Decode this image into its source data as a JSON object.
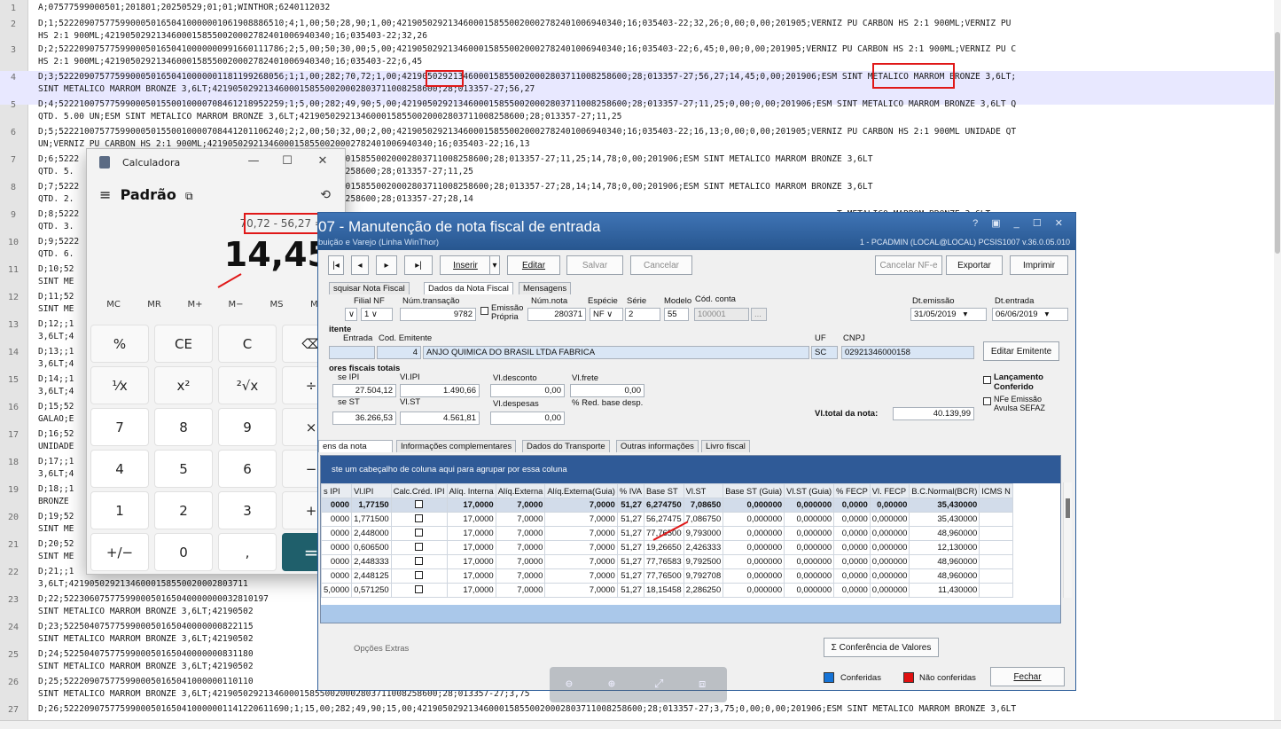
{
  "editor": {
    "lines": [
      {
        "n": "1",
        "text": [
          "A;07577599000501;201801;20250529;01;01;WINTHOR;6240112032"
        ]
      },
      {
        "n": "2",
        "text": [
          "D;1;52220907577599000501650410000001061908886510;4;1,00;50;28,90;1,00;42190502921346000158550020002782401006940340;16;035403-22;32,26;0,00;0,00;201905;VERNIZ PU CARBON HS 2:1 900ML;VERNIZ PU",
          "HS 2:1 900ML;42190502921346000158550020002782401006940340;16;035403-22;32,26"
        ]
      },
      {
        "n": "3",
        "text": [
          "D;2;52220907577599000501650410000000991660111786;2;5,00;50;30,00;5,00;42190502921346000158550020002782401006940340;16;035403-22;6,45;0,00;0,00;201905;VERNIZ PU CARBON HS 2:1 900ML;VERNIZ PU C",
          "HS 2:1 900ML;42190502921346000158550020002782401006940340;16;035403-22;6,45"
        ]
      },
      {
        "n": "4",
        "text": [
          "D;3;52220907577599000501650410000001181199268056;1;1,00;282;70,72;1,00;42190502921346000158550020002803711008258600;28;013357-27;56,27;14,45;0,00;201906;ESM SINT METALICO MARROM BRONZE 3,6LT;",
          "SINT METALICO MARROM BRONZE 3,6LT;42190502921346000158550020002803711008258600;28;013357-27;56,27"
        ]
      },
      {
        "n": "5",
        "text": [
          "D;4;52221007577599000501550010000708461218952259;1;5,00;282;49,90;5,00;42190502921346000158550020002803711008258600;28;013357-27;11,25;0,00;0,00;201906;ESM SINT METALICO MARROM BRONZE 3,6LT Q",
          "QTD. 5.00 UN;ESM SINT METALICO MARROM BRONZE 3,6LT;42190502921346000158550020002803711008258600;28;013357-27;11,25"
        ]
      },
      {
        "n": "6",
        "text": [
          "D;5;52221007577599000501550010000708441201106240;2;2,00;50;32,00;2,00;42190502921346000158550020002782401006940340;16;035403-22;16,13;0,00;0,00;201905;VERNIZ PU CARBON HS 2:1 900ML UNIDADE QT",
          "UN;VERNIZ PU CARBON HS 2:1 900ML;42190502921346000158550020002782401006940340;16;035403-22;16,13"
        ]
      },
      {
        "n": "7",
        "text": [
          "D;6;5222            4;2;5,00;282;71,06;5,00;42190502921346000158550020002803711008258600;28;013357-27;11,25;14,78;0,00;201906;ESM SINT METALICO MARROM BRONZE 3,6LT",
          "QTD. 5.            LT;42190502921346000158550020002803711008258600;28;013357-27;11,25"
        ]
      },
      {
        "n": "8",
        "text": [
          "D;7;5222            0;2;2,00;282;71,06;2,00;42190502921346000158550020002803711008258600;28;013357-27;28,14;14,78;0,00;201906;ESM SINT METALICO MARROM BRONZE 3,6LT",
          "QTD. 2.            LT;42190502921346000158550020002803711008258600;28;013357-27;28,14"
        ]
      },
      {
        "n": "9",
        "text": [
          "D;8;5222                                                                                                                                                    T METALICO MARROM BRONZE 3,6LT",
          "QTD. 3."
        ]
      },
      {
        "n": "10",
        "text": [
          "D;9;5222                                                                                                                                                    METALICO MARROM BRONZE 3,6LT Q",
          "QTD. 6."
        ]
      },
      {
        "n": "11",
        "text": [
          "D;10;52                                                                                                                                                    INT METALICO MARROM BRONZE 3,6L",
          "SINT ME"
        ]
      },
      {
        "n": "12",
        "text": [
          "D;11;52                                                                                                                                                    T METALICO MARROM BRONZE 3,6LT;",
          "SINT ME"
        ]
      },
      {
        "n": "13",
        "text": [
          "D;12;;1                                                                                                                                                    M AVELA",
          "3,6LT;4"
        ]
      },
      {
        "n": "14",
        "text": [
          "D;13;;1                                                                                                                                                    AVELA",
          "3,6LT;4"
        ]
      },
      {
        "n": "15",
        "text": [
          "D;14;;1                                                                                                                                                    ALICO MARROM BRONZE",
          "3,6LT;4"
        ]
      },
      {
        "n": "16",
        "text": [
          "D;15;52                                                                                                                                                    NT METALICO MARROM BRONZE 3,6LT",
          "GALAO;E"
        ]
      },
      {
        "n": "17",
        "text": [
          "D;16;52                                                                                                                                                    SINT METALICO MARROM BRONZE 3,6L",
          "UNIDADE"
        ]
      },
      {
        "n": "18",
        "text": [
          "D;17;;1                                                                                                                                                    SAVOIA",
          "3,6LT;4"
        ]
      },
      {
        "n": "19",
        "text": [
          "D;18;;1                                                                                                                                                    D. 1.00 UN;ESM SINT METALICO MA",
          "BRONZE"
        ]
      },
      {
        "n": "20",
        "text": [
          "D;19;52                                                                                                                                                    SINT METALICO MARROM BRONZE 3,6",
          "SINT ME"
        ]
      },
      {
        "n": "21",
        "text": [
          "D;20;52                                                                                                                                                    SINT METALICO MARROM BRONZE 3,6",
          "SINT ME"
        ]
      },
      {
        "n": "22",
        "text": [
          "D;21;;1                                                                                                                                                    ALICO MARROM BRONZE",
          "3,6LT;42190502921346000158550020002803711"
        ]
      },
      {
        "n": "23",
        "text": [
          "D;22;5223060757759900050165040000000032810197                                                                                                              NT METALICO MARROM BRONZE 3,6LT",
          "SINT METALICO MARROM BRONZE 3,6LT;42190502"
        ]
      },
      {
        "n": "24",
        "text": [
          "D;23;5225040757759900050165040000000822115                                                                                                                NT METALICO MARROM BRONZE 3,6LT",
          "SINT METALICO MARROM BRONZE 3,6LT;42190502"
        ]
      },
      {
        "n": "25",
        "text": [
          "D;24;5225040757759900050165040000000831180                                                                                                                NT METALICO MARROM BRONZE 3,6LT",
          "SINT METALICO MARROM BRONZE 3,6LT;42190502"
        ]
      },
      {
        "n": "26",
        "text": [
          "D;25;5222090757759900050165041000000110110                                                                                                                NT METALICO MARROM BRONZE 3,6LT",
          "SINT METALICO MARROM BRONZE 3,6LT;42190502921346000158550020002803711008258600;28;013357-27;3,75"
        ]
      },
      {
        "n": "27",
        "text": [
          "D;26;52220907577599000501650410000001141220611690;1;15,00;282;49,90;15,00;42190502921346000158550020002803711008258600;28;013357-27;3,75;0,00;0,00;201906;ESM SINT METALICO MARROM BRONZE 3,6LT"
        ]
      }
    ]
  },
  "calculator": {
    "title": "Calculadora",
    "mode": "Padrão",
    "expression": "70,72 - 56,27 =",
    "result": "14,45",
    "memory": [
      "MC",
      "MR",
      "M+",
      "M−",
      "MS",
      "M∨"
    ],
    "keys": [
      [
        "%",
        "CE",
        "C",
        "⌫"
      ],
      [
        "¹⁄x",
        "x²",
        "²√x",
        "÷"
      ],
      [
        "7",
        "8",
        "9",
        "×"
      ],
      [
        "4",
        "5",
        "6",
        "−"
      ],
      [
        "1",
        "2",
        "3",
        "+"
      ],
      [
        "+/−",
        "0",
        ",",
        "="
      ]
    ]
  },
  "winthor": {
    "title": "07 - Manutenção de nota fiscal de entrada",
    "subtitle": "buição e Varejo (Linha WinThor)",
    "session": "1 - PCADMIN (LOCAL@LOCAL)  PCSIS1007  v.36.0.05.010",
    "toolbar": {
      "first": "|◂",
      "prev": "◂",
      "next": "▸",
      "last": "▸|",
      "insert": "Inserir",
      "edit": "Editar",
      "save": "Salvar",
      "cancel": "Cancelar",
      "cancel_nfe": "Cancelar NF-e",
      "export": "Exportar",
      "print": "Imprimir"
    },
    "top_tabs": [
      "squisar Nota Fiscal",
      "Dados da Nota Fiscal",
      "Mensagens"
    ],
    "fields": {
      "filial_label": "Filial NF",
      "filial": "1",
      "trans_label": "Núm.transação",
      "trans": "9782",
      "emissao_propria": "Emissão Própria",
      "nota_label": "Núm.nota",
      "nota": "280371",
      "especie_label": "Espécie",
      "especie": "NF",
      "serie_label": "Série",
      "serie": "2",
      "modelo_label": "Modelo",
      "modelo": "55",
      "conta_label": "Cód. conta",
      "conta": "100001",
      "conta_btn": "...",
      "dtemissao_label": "Dt.emissão",
      "dtemissao": "31/05/2019",
      "dtentrada_label": "Dt.entrada",
      "dtentrada": "06/06/2019",
      "emitente_head": "itente",
      "entrada_label": "Entrada",
      "cod_emit_label": "Cod. Emitente",
      "cod_emit": "4",
      "emit_name": "ANJO QUIMICA DO BRASIL LTDA FABRICA",
      "uf_label": "UF",
      "uf": "SC",
      "cnpj_label": "CNPJ",
      "cnpj": "02921346000158",
      "edit_emit": "Editar Emitente",
      "totais_head": "ores fiscais totais",
      "base_ipi_label": "se IPI",
      "base_ipi": "27.504,12",
      "vl_ipi_label": "Vl.IPI",
      "vl_ipi": "1.490,66",
      "desc_label": "Vl.desconto",
      "desc": "0,00",
      "frete_label": "Vl.frete",
      "frete": "0,00",
      "base_st_label": "se ST",
      "base_st": "36.266,53",
      "vl_st_label": "Vl.ST",
      "vl_st": "4.561,81",
      "desp_label": "Vl.despesas",
      "desp": "0,00",
      "red_label": "% Red. base desp.",
      "total_label": "Vl.total da nota:",
      "total": "40.139,99",
      "lanc": "Lançamento Conferido",
      "nfe_emissao": "NFe Emissão Avulsa SEFAZ"
    },
    "sub_tabs": [
      "ens da nota",
      "Informações complementares",
      "Dados do Transporte",
      "Outras informações",
      "Livro fiscal"
    ],
    "group_hint": "ste um cabeçalho de coluna aqui para agrupar por essa coluna",
    "columns": [
      "s IPI",
      "Vl.IPI",
      "Calc.Créd. IPI",
      "Alíq. Interna",
      "Alíq.Externa",
      "Alíq.Externa(Guia)",
      "% IVA",
      "Base ST",
      "Vl.ST",
      "Base ST (Guia)",
      "Vl.ST (Guia)",
      "% FECP",
      "Vl. FECP",
      "B.C.Normal(BCR)",
      "ICMS N"
    ],
    "rows": [
      [
        "0000",
        "1,77150",
        "",
        "17,0000",
        "7,0000",
        "7,0000",
        "51,27",
        "6,274750",
        "7,08650",
        "0,000000",
        "0,000000",
        "0,0000",
        "0,00000",
        "35,430000",
        ""
      ],
      [
        "0000",
        "1,771500",
        "",
        "17,0000",
        "7,0000",
        "7,0000",
        "51,27",
        "56,27475",
        "7,086750",
        "0,000000",
        "0,000000",
        "0,0000",
        "0,000000",
        "35,430000",
        ""
      ],
      [
        "0000",
        "2,448000",
        "",
        "17,0000",
        "7,0000",
        "7,0000",
        "51,27",
        "77,76500",
        "9,793000",
        "0,000000",
        "0,000000",
        "0,0000",
        "0,000000",
        "48,960000",
        ""
      ],
      [
        "0000",
        "0,606500",
        "",
        "17,0000",
        "7,0000",
        "7,0000",
        "51,27",
        "19,26650",
        "2,426333",
        "0,000000",
        "0,000000",
        "0,0000",
        "0,000000",
        "12,130000",
        ""
      ],
      [
        "0000",
        "2,448333",
        "",
        "17,0000",
        "7,0000",
        "7,0000",
        "51,27",
        "77,76583",
        "9,792500",
        "0,000000",
        "0,000000",
        "0,0000",
        "0,000000",
        "48,960000",
        ""
      ],
      [
        "0000",
        "2,448125",
        "",
        "17,0000",
        "7,0000",
        "7,0000",
        "51,27",
        "77,76500",
        "9,792708",
        "0,000000",
        "0,000000",
        "0,0000",
        "0,000000",
        "48,960000",
        ""
      ],
      [
        "5,0000",
        "0,571250",
        "",
        "17,0000",
        "7,0000",
        "7,0000",
        "51,27",
        "18,15458",
        "2,286250",
        "0,000000",
        "0,000000",
        "0,0000",
        "0,000000",
        "11,430000",
        ""
      ]
    ],
    "extras": "Opções Extras",
    "conf_valores": "Conferência de Valores",
    "conferidas": "Conferidas",
    "nao_conferidas": "Não conferidas",
    "fechar": "Fechar",
    "colors": {
      "conferidas": "#1573d6",
      "nao_conferidas": "#e01010",
      "header": "#2f5a97"
    }
  },
  "overlay_icons": [
    "zoom-out-icon",
    "zoom-in-icon",
    "fullscreen-icon",
    "screenshot-icon"
  ]
}
